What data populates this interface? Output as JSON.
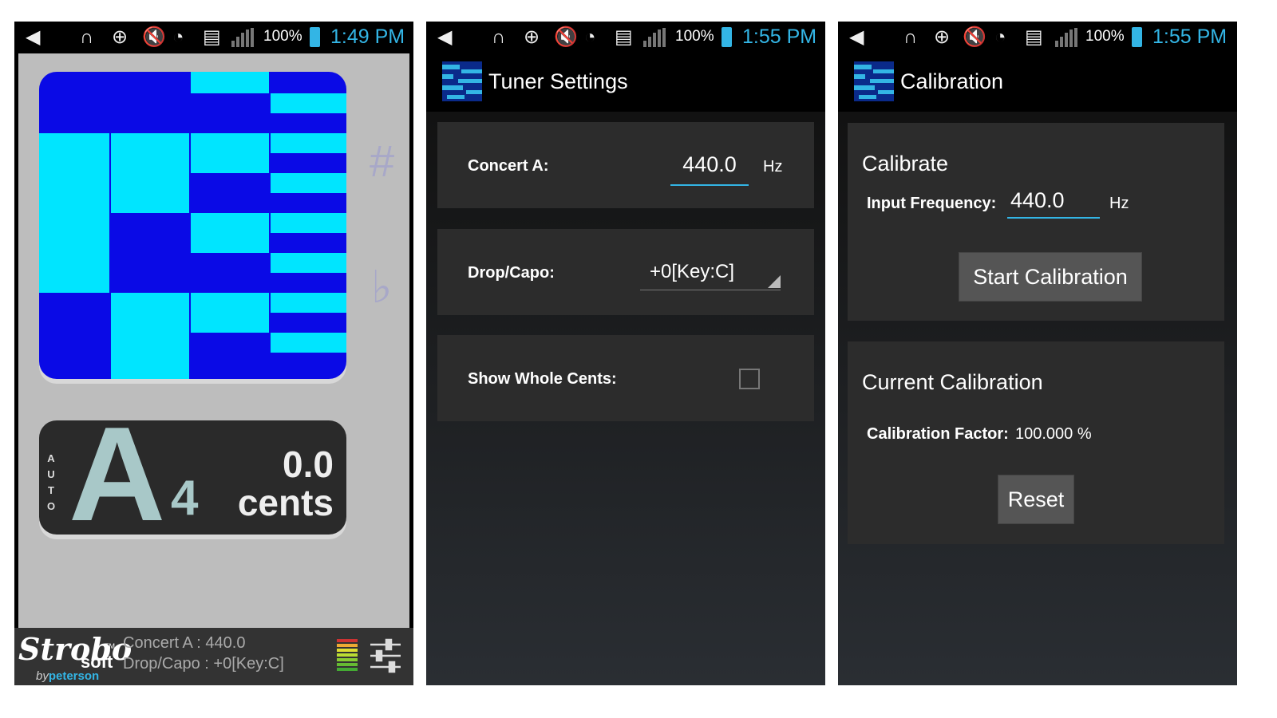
{
  "status_bars": [
    {
      "battery": "100%",
      "time": "1:49 PM"
    },
    {
      "battery": "100%",
      "time": "1:55 PM"
    },
    {
      "battery": "100%",
      "time": "1:55 PM"
    }
  ],
  "tuner": {
    "sharp_symbol": "#",
    "flat_symbol": "♭",
    "auto_label": "AUTO",
    "note": "A",
    "octave": "4",
    "cents_value": "0.0",
    "cents_label": "cents",
    "strobe_colors": {
      "dark": "#0a0ae6",
      "light": "#00e5ff"
    },
    "footer": {
      "logo_script": "Strobo",
      "logo_soft": "soft",
      "logo_tm": "TM",
      "logo_by": "by",
      "logo_brand": "peterson",
      "concert_a_line": "Concert A : 440.0",
      "drop_capo_line": "Drop/Capo : +0[Key:C]"
    }
  },
  "tuner_settings": {
    "title": "Tuner Settings",
    "concert_a_label": "Concert A:",
    "concert_a_value": "440.0",
    "concert_a_unit": "Hz",
    "drop_capo_label": "Drop/Capo:",
    "drop_capo_value": "+0[Key:C]",
    "show_whole_cents_label": "Show Whole Cents:",
    "show_whole_cents_checked": false
  },
  "calibration": {
    "title": "Calibration",
    "calibrate_heading": "Calibrate",
    "input_frequency_label": "Input Frequency:",
    "input_frequency_value": "440.0",
    "input_frequency_unit": "Hz",
    "start_button": "Start Calibration",
    "current_heading": "Current Calibration",
    "factor_label": "Calibration Factor:",
    "factor_value": "100.000 %",
    "reset_button": "Reset"
  },
  "accent_color": "#33b5e5"
}
